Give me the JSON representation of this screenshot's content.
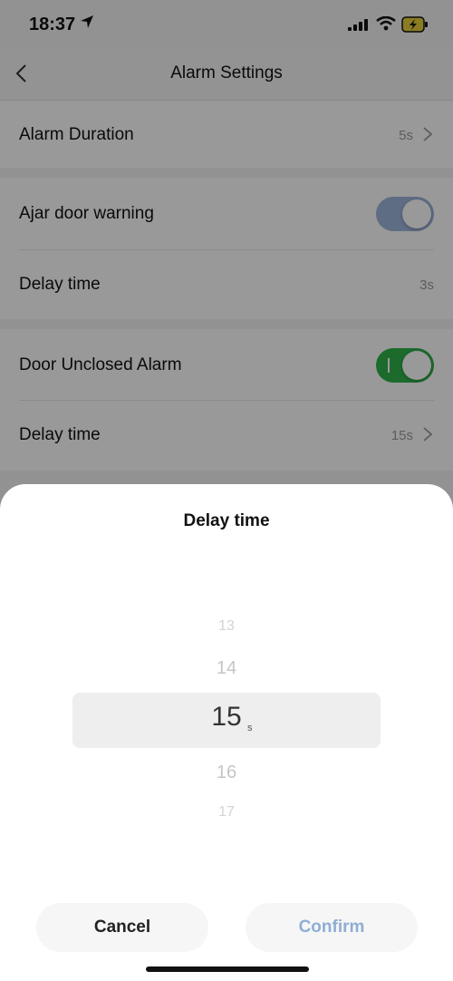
{
  "status_bar": {
    "time": "18:37"
  },
  "nav": {
    "title": "Alarm Settings"
  },
  "settings": {
    "alarm_duration": {
      "label": "Alarm Duration",
      "value": "5s"
    },
    "ajar_door_warning": {
      "label": "Ajar door warning",
      "enabled": true
    },
    "ajar_delay": {
      "label": "Delay time",
      "value": "3s"
    },
    "door_unclosed_alarm": {
      "label": "Door Unclosed Alarm",
      "enabled": true
    },
    "unclosed_delay": {
      "label": "Delay time",
      "value": "15s"
    }
  },
  "sheet": {
    "title": "Delay time",
    "picker": {
      "above": [
        "13",
        "14"
      ],
      "selected": "15",
      "unit": "s",
      "below": [
        "16",
        "17"
      ]
    },
    "cancel_label": "Cancel",
    "confirm_label": "Confirm"
  },
  "colors": {
    "toggle_ajar": "#9db6dc",
    "toggle_unclosed": "#2fb24a",
    "confirm_text": "#8eaed4"
  },
  "icons": {
    "back": "chevron-left-icon",
    "location": "location-arrow-icon",
    "signal": "cellular-signal-icon",
    "wifi": "wifi-icon",
    "battery": "battery-charging-icon",
    "chevron": "chevron-right-icon"
  }
}
